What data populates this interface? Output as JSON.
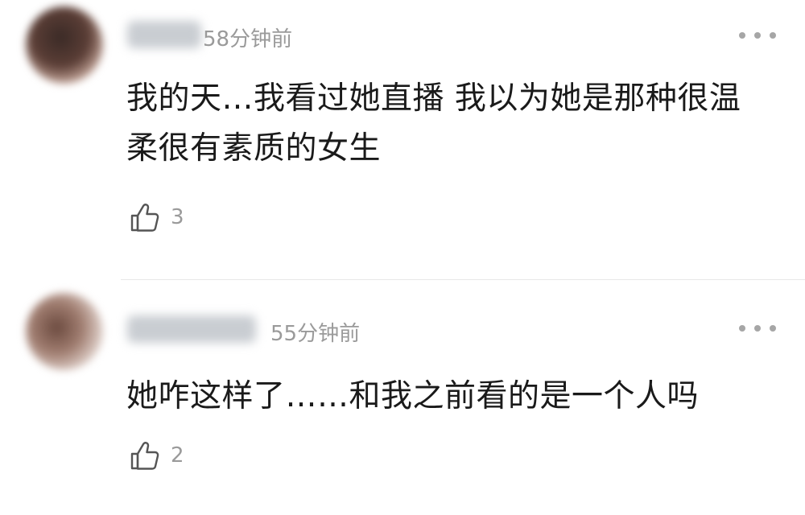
{
  "comments": [
    {
      "time": "58分钟前",
      "text_line1": "我的天…我看过她直播 我以为她是那种很温",
      "text_line2": "柔很有素质的女生",
      "likes": "3",
      "avatar_icon": "user-avatar-blurred",
      "more_icon": "more-dots-icon",
      "like_icon": "thumbs-up-icon"
    },
    {
      "time": "55分钟前",
      "text_line1": "她咋这样了……和我之前看的是一个人吗",
      "likes": "2",
      "avatar_icon": "user-avatar-blurred",
      "more_icon": "more-dots-icon",
      "like_icon": "thumbs-up-icon"
    }
  ],
  "colors": {
    "text_primary": "#1a1a1a",
    "text_secondary": "#9a9a9a",
    "divider": "#e8e8e8",
    "background": "#ffffff"
  }
}
